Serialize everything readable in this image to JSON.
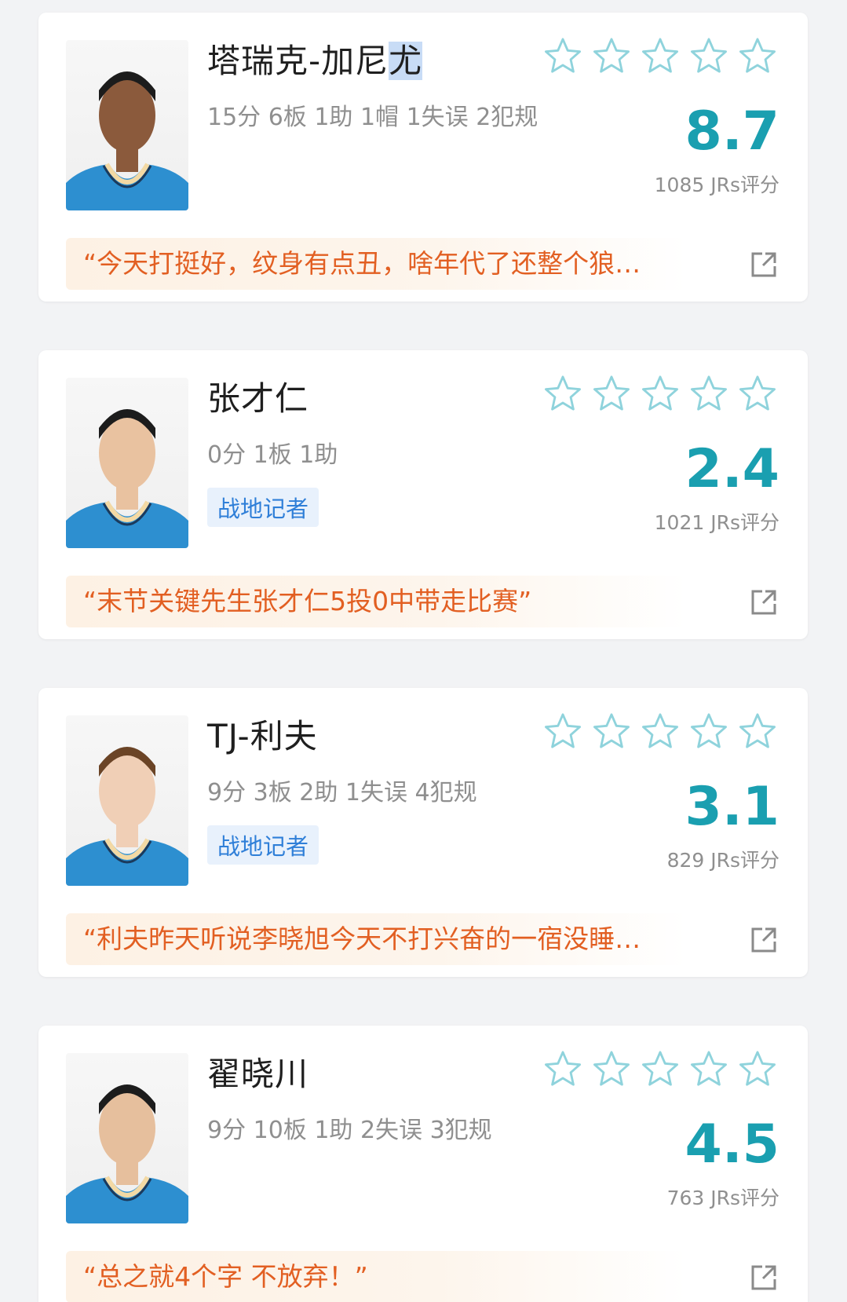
{
  "colors": {
    "background": "#f2f3f5",
    "card": "#ffffff",
    "score": "#1a9fb0",
    "star_outline": "#8fd3dc",
    "comment_text": "#e25f22",
    "comment_bg": "#fdf1e4",
    "tag_text": "#2f7fd8",
    "tag_bg": "#e8f1fc"
  },
  "players": [
    {
      "name_main": "塔瑞克-加尼",
      "name_highlight": "尤",
      "stats": "15分 6板 1助 1帽 1失误 2犯规",
      "tag": "",
      "score": "8.7",
      "rating_count": "1085 JRs评分",
      "comment": "“今天打挺好，纹身有点丑，啥年代了还整个狼…",
      "stars_filled": 0,
      "icons": {
        "photo": "player-photo",
        "share": "share-icon",
        "star": "star-outline-icon"
      }
    },
    {
      "name_main": "张才仁",
      "name_highlight": "",
      "stats": "0分 1板 1助",
      "tag": "战地记者",
      "score": "2.4",
      "rating_count": "1021 JRs评分",
      "comment": "“末节关键先生张才仁5投0中带走比赛”",
      "stars_filled": 0,
      "icons": {
        "photo": "player-photo",
        "share": "share-icon",
        "star": "star-outline-icon"
      }
    },
    {
      "name_main": "TJ-利夫",
      "name_highlight": "",
      "stats": "9分 3板 2助 1失误 4犯规",
      "tag": "战地记者",
      "score": "3.1",
      "rating_count": "829 JRs评分",
      "comment": "“利夫昨天听说李晓旭今天不打兴奋的一宿没睡…",
      "stars_filled": 0,
      "icons": {
        "photo": "player-photo",
        "share": "share-icon",
        "star": "star-outline-icon"
      }
    },
    {
      "name_main": "翟晓川",
      "name_highlight": "",
      "stats": "9分 10板 1助 2失误 3犯规",
      "tag": "",
      "score": "4.5",
      "rating_count": "763 JRs评分",
      "comment": "“总之就4个字 不放弃！”",
      "stars_filled": 0,
      "icons": {
        "photo": "player-photo",
        "share": "share-icon",
        "star": "star-outline-icon"
      }
    }
  ]
}
